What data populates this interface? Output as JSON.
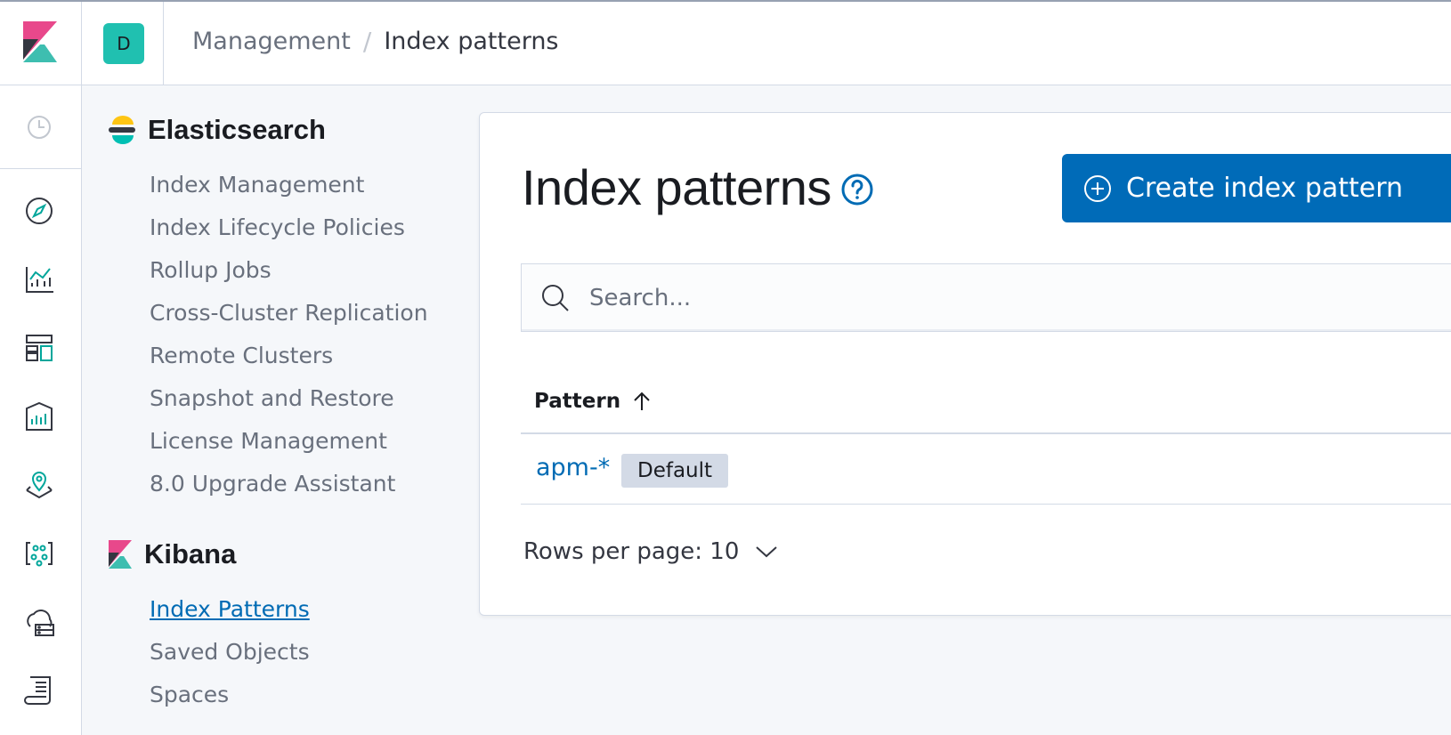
{
  "header": {
    "space_initial": "D",
    "breadcrumbs": [
      "Management",
      "Index patterns"
    ],
    "separator": "/"
  },
  "rail": {
    "icons": [
      "recently-viewed-icon",
      "discover-icon",
      "visualize-icon",
      "dashboard-icon",
      "canvas-icon",
      "maps-icon",
      "machine-learning-icon",
      "infrastructure-icon",
      "logs-icon"
    ]
  },
  "sidebar": {
    "elasticsearch": {
      "title": "Elasticsearch",
      "items": [
        "Index Management",
        "Index Lifecycle Policies",
        "Rollup Jobs",
        "Cross-Cluster Replication",
        "Remote Clusters",
        "Snapshot and Restore",
        "License Management",
        "8.0 Upgrade Assistant"
      ]
    },
    "kibana": {
      "title": "Kibana",
      "items": [
        "Index Patterns",
        "Saved Objects",
        "Spaces"
      ],
      "active_item": "Index Patterns"
    }
  },
  "main": {
    "title": "Index patterns",
    "create_button": "Create index pattern",
    "search_placeholder": "Search...",
    "table": {
      "column": "Pattern",
      "sort": "ascending",
      "rows": [
        {
          "pattern": "apm-*",
          "badge": "Default"
        }
      ]
    },
    "rows_per_page": "Rows per page: 10"
  },
  "colors": {
    "accent": "#006bb8",
    "link": "#006bb4",
    "space_avatar": "#20c0b0",
    "kibana_pink": "#e8488b",
    "kibana_teal": "#3ebeb0",
    "elastic_yellow": "#fec514"
  }
}
